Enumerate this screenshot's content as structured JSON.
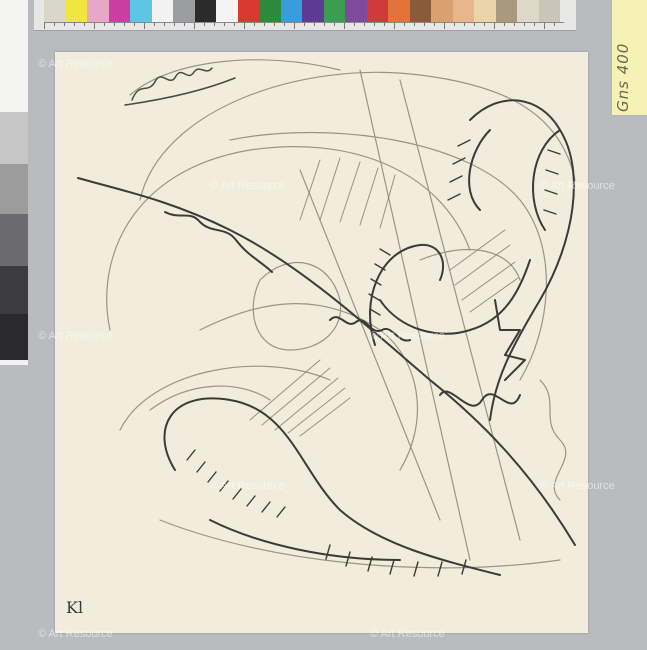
{
  "note": {
    "text": "Gns 400"
  },
  "monogram": {
    "text": "Kl"
  },
  "watermark": {
    "text": "© Art Resource"
  },
  "colors": {
    "background": "#b9bcbf",
    "paper": "#f1ecdc",
    "ink_dark": "#3b3b39",
    "ink_light": "#8a8770",
    "note": "#f6f2b5"
  },
  "color_swatches": [
    "#d9d7c8",
    "#f1e542",
    "#e6a8c6",
    "#c93ea0",
    "#5dc6e7",
    "#f2f2f2",
    "#9b9ea0",
    "#2b2b2b",
    "#f4f4f4",
    "#d9392f",
    "#2c8a3d",
    "#3a9ddb",
    "#5c3b95",
    "#3b9d4f",
    "#7f4a9b",
    "#cf3a3a",
    "#e2733a",
    "#8b5a3a",
    "#d9a070",
    "#e8b68a",
    "#e9d5a8",
    "#a89a7c",
    "#ddd9c8",
    "#c9c6b8"
  ],
  "grayscale_steps": [
    "#f4f4f3",
    "#dcdcdc",
    "#c6c6c6",
    "#9c9c9d",
    "#6b6b6d",
    "#3c3c3e",
    "#2a2a2c",
    "#f2f2f2"
  ]
}
